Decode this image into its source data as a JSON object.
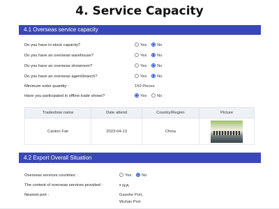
{
  "page": {
    "title": "4. Service Capacity"
  },
  "section1": {
    "title": "4.1 Overseas service capacity",
    "questions": [
      {
        "label": "Do you have in-stock capacity?",
        "options": [
          "Yes",
          "No"
        ],
        "selected": "No"
      },
      {
        "label": "Do you have an overseas warehouse?",
        "options": [
          "Yes",
          "No"
        ],
        "selected": "No"
      },
      {
        "label": "Do you have an overseas showroom?",
        "options": [
          "Yes",
          "No"
        ],
        "selected": "No"
      },
      {
        "label": "Do you have an overseas agent/branch?",
        "options": [
          "Yes",
          "No"
        ],
        "selected": "No"
      }
    ],
    "min_order": {
      "label": "Minimum order quantity :",
      "value": "150 Pieces"
    },
    "trade_show_q": {
      "label": "Have you participated in offline trade shows?",
      "options": [
        "Yes",
        "No"
      ],
      "selected": "Yes"
    },
    "table": {
      "headers": [
        "Tradeshow name",
        "Date attend",
        "Country/Region",
        "Picture"
      ],
      "rows": [
        {
          "name": "Canton Fair",
          "date": "2023-04-13",
          "country": "China",
          "picture": "trade-show-photo"
        }
      ]
    }
  },
  "section2": {
    "title": "4.2 Export Overall Situation",
    "overseas_countries": {
      "label": "Overseas services countries :",
      "options": [
        "Yes",
        "No"
      ],
      "selected": "No"
    },
    "content": {
      "label": "The content of overseas services provided :",
      "value": "N/A"
    },
    "nearest_port": {
      "label": "Nearest port :",
      "value": "Gaoshe Port, Wuhan Port"
    }
  }
}
